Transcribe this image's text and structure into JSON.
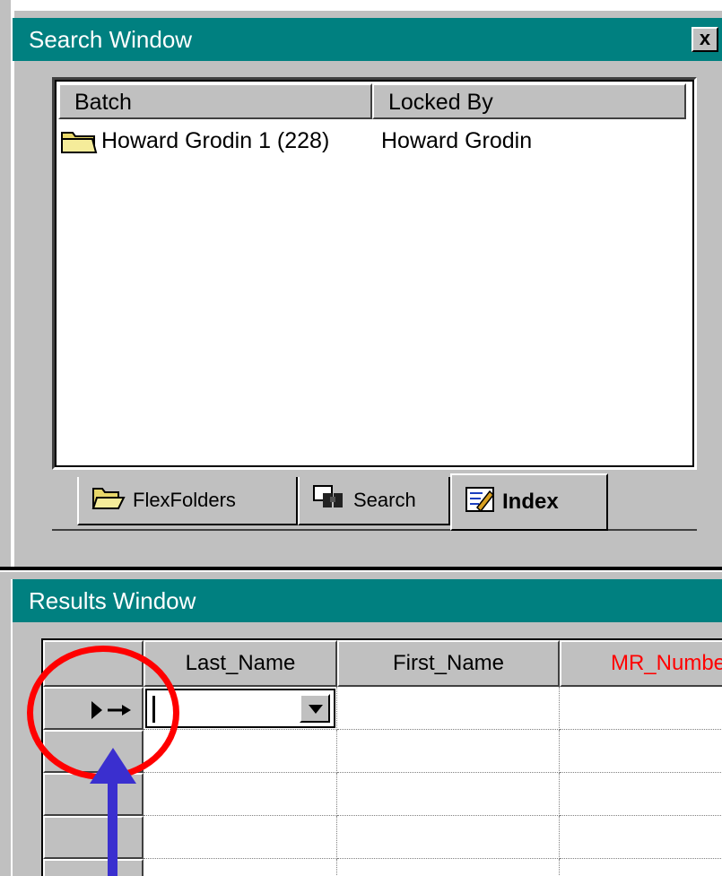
{
  "search_window": {
    "title": "Search Window",
    "close_glyph": "x",
    "list": {
      "columns": [
        "Batch",
        "Locked By"
      ],
      "rows": [
        {
          "batch": "Howard Grodin 1 (228)",
          "locked_by": "Howard Grodin",
          "icon": "folder-icon"
        }
      ]
    },
    "tabs": [
      {
        "label": "FlexFolders",
        "icon": "open-folder-icon",
        "active": false
      },
      {
        "label": "Search",
        "icon": "binoculars-icon",
        "active": false
      },
      {
        "label": "Index",
        "icon": "index-card-icon",
        "active": true
      }
    ]
  },
  "results_window": {
    "title": "Results Window",
    "columns": [
      "Last_Name",
      "First_Name",
      "MR_Number"
    ],
    "required_color": "#ff0000",
    "current_row_indicator": "new-record-arrow-icon"
  },
  "annotation": {
    "circle_color": "#ff0000",
    "arrow_color": "#3a2fcf"
  }
}
